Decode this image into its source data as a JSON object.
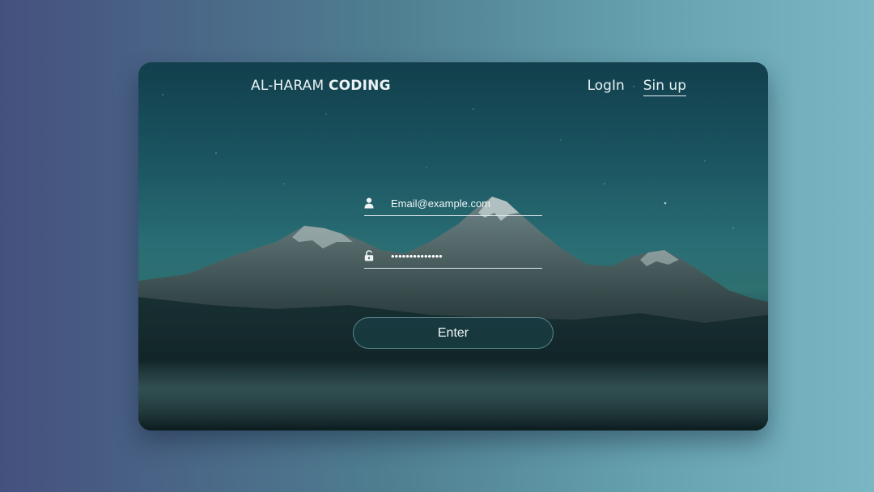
{
  "nav": {
    "brand_light": "AL-HARAM",
    "brand_bold": "CODING",
    "links": [
      {
        "label": "LogIn"
      },
      {
        "label": "Sin up"
      }
    ]
  },
  "form": {
    "email": {
      "placeholder": "Email@example.com",
      "icon": "user-icon"
    },
    "password": {
      "value": "••••••••••••••",
      "icon": "unlock-icon"
    },
    "submit_label": "Enter"
  },
  "colors": {
    "page_gradient_start": "#45507e",
    "page_gradient_end": "#7ab6c3",
    "text": "#e9f2f4",
    "button_bg": "#183c42"
  }
}
